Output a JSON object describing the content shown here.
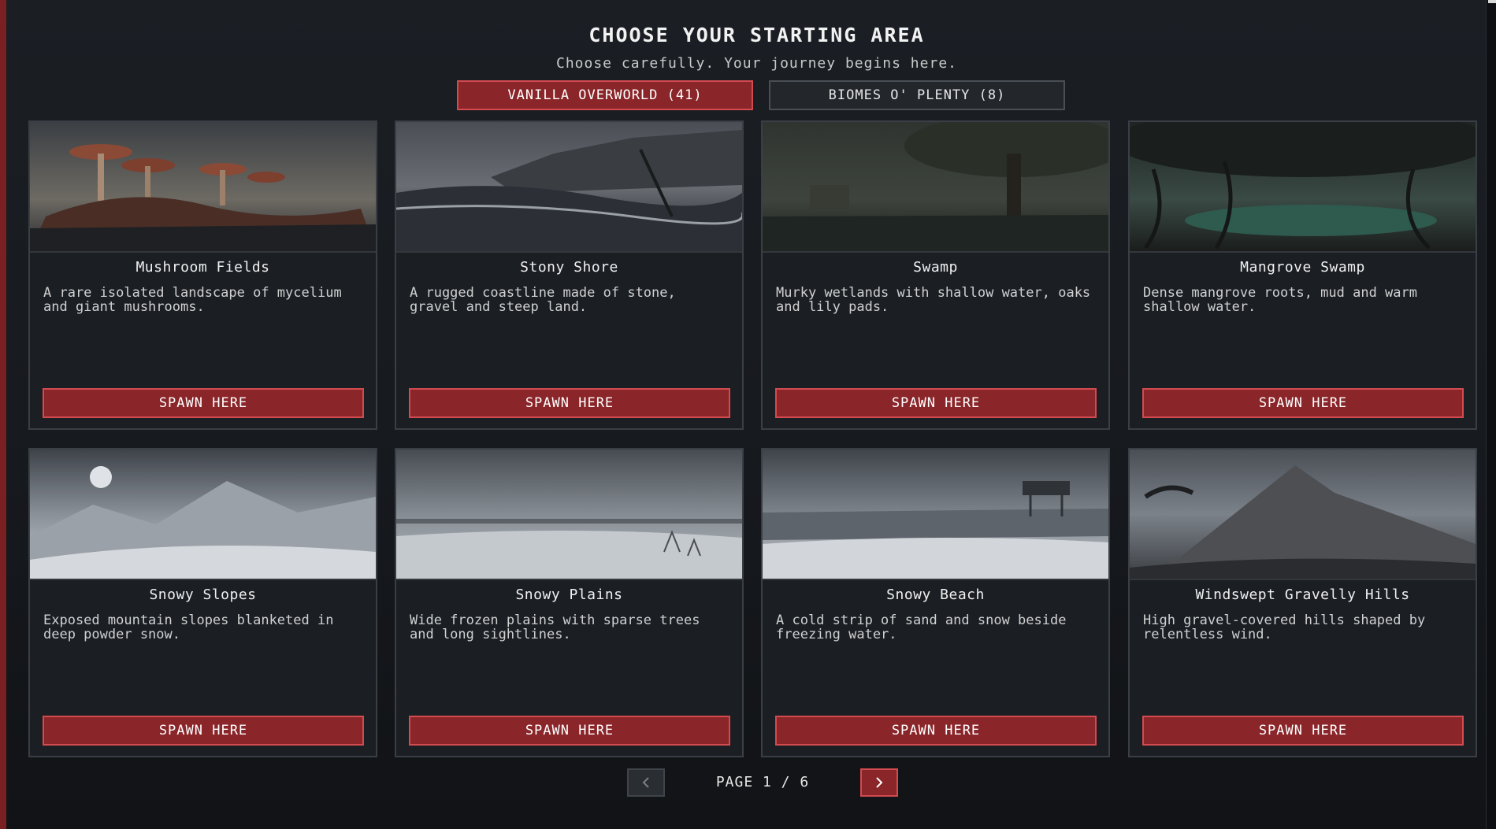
{
  "header": {
    "title": "CHOOSE YOUR STARTING AREA",
    "subtitle": "Choose carefully. Your journey begins here."
  },
  "tabs": [
    {
      "label": "VANILLA OVERWORLD (41)",
      "active": true
    },
    {
      "label": "BIOMES O' PLENTY (8)",
      "active": false
    }
  ],
  "cards": [
    {
      "title": "Mushroom Fields",
      "description": "A rare isolated landscape of mycelium and giant mushrooms.",
      "button": "SPAWN HERE"
    },
    {
      "title": "Stony Shore",
      "description": "A rugged coastline made of stone, gravel and steep land.",
      "button": "SPAWN HERE"
    },
    {
      "title": "Swamp",
      "description": "Murky wetlands with shallow water, oaks and lily pads.",
      "button": "SPAWN HERE"
    },
    {
      "title": "Mangrove Swamp",
      "description": "Dense mangrove roots, mud and warm shallow water.",
      "button": "SPAWN HERE"
    },
    {
      "title": "Snowy Slopes",
      "description": "Exposed mountain slopes blanketed in deep powder snow.",
      "button": "SPAWN HERE"
    },
    {
      "title": "Snowy Plains",
      "description": "Wide frozen plains with sparse trees and long sightlines.",
      "button": "SPAWN HERE"
    },
    {
      "title": "Snowy Beach",
      "description": "A cold strip of sand and snow beside freezing water.",
      "button": "SPAWN HERE"
    },
    {
      "title": "Windswept Gravelly Hills",
      "description": "High gravel-covered hills shaped by relentless wind.",
      "button": "SPAWN HERE"
    }
  ],
  "pagination": {
    "label": "PAGE 1 / 6",
    "prev_icon": "chevron-left-icon",
    "next_icon": "chevron-right-icon"
  },
  "colors": {
    "accent": "#8a2529",
    "accent_border": "#d24b4f",
    "background": "#14171b",
    "card": "#1b1f24"
  }
}
